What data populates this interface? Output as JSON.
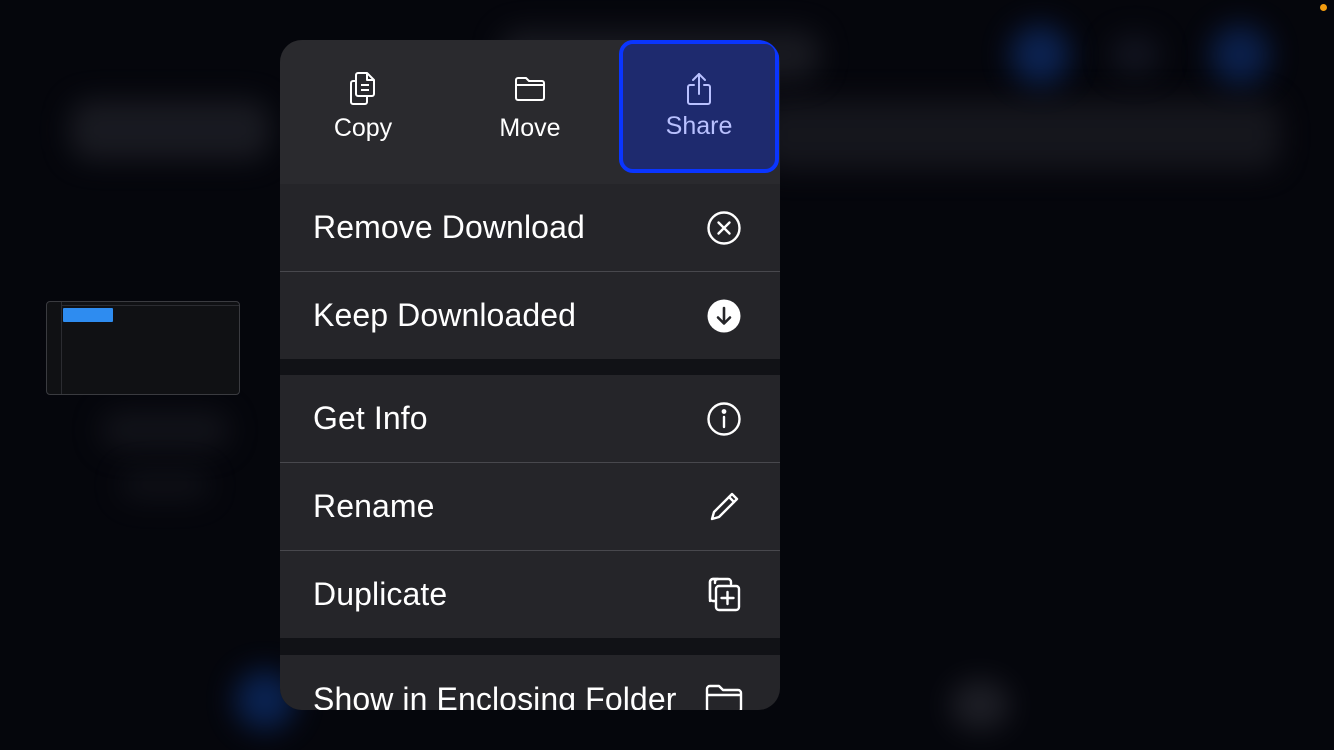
{
  "actions": {
    "copy": {
      "label": "Copy",
      "icon": "doc-on-doc-icon"
    },
    "move": {
      "label": "Move",
      "icon": "folder-icon"
    },
    "share": {
      "label": "Share",
      "icon": "share-icon"
    }
  },
  "menu": {
    "group1": [
      {
        "label": "Remove Download",
        "icon": "xmark-circle-icon"
      },
      {
        "label": "Keep Downloaded",
        "icon": "arrow-down-circle-fill-icon"
      }
    ],
    "group2": [
      {
        "label": "Get Info",
        "icon": "info-circle-icon"
      },
      {
        "label": "Rename",
        "icon": "pencil-icon"
      },
      {
        "label": "Duplicate",
        "icon": "plus-square-on-square-icon"
      }
    ],
    "group3": [
      {
        "label": "Show in Enclosing Folder",
        "icon": "folder-icon"
      }
    ]
  },
  "colors": {
    "share_highlight_border": "#0a35ff",
    "share_highlight_fill": "#1e2a6e",
    "menu_row_bg": "#252529",
    "status_dot": "#f29b0f"
  }
}
